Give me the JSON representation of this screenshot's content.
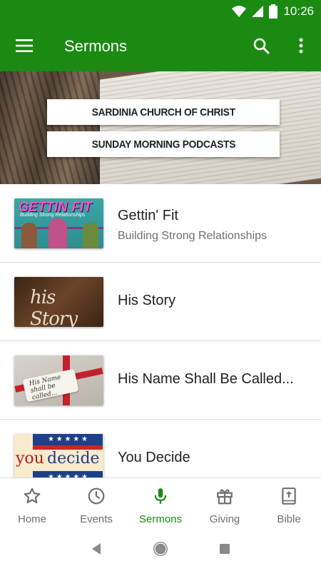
{
  "status_bar": {
    "time": "10:26"
  },
  "app_bar": {
    "title": "Sermons"
  },
  "banner": {
    "line1": "SARDINIA CHURCH OF CHRIST",
    "line2": "SUNDAY MORNING PODCASTS"
  },
  "sermons": [
    {
      "title": "Gettin' Fit",
      "subtitle": "Building Strong Relationships",
      "thumb_text": "GETTIN FIT",
      "thumb_subtext": "Building Strong Relationships"
    },
    {
      "title": "His Story",
      "subtitle": "",
      "thumb_text": "his Story"
    },
    {
      "title": "His Name Shall Be Called...",
      "subtitle": "",
      "thumb_text": "His Name shall be called..."
    },
    {
      "title": "You Decide",
      "subtitle": "",
      "thumb_text_1": "you",
      "thumb_text_2": "decide"
    }
  ],
  "bottom_nav": [
    {
      "label": "Home",
      "icon": "star-icon",
      "active": false
    },
    {
      "label": "Events",
      "icon": "clock-icon",
      "active": false
    },
    {
      "label": "Sermons",
      "icon": "microphone-icon",
      "active": true
    },
    {
      "label": "Giving",
      "icon": "gift-icon",
      "active": false
    },
    {
      "label": "Bible",
      "icon": "bible-icon",
      "active": false
    }
  ],
  "colors": {
    "primary": "#1b8a12",
    "text_primary": "#212121",
    "text_secondary": "#6f6f6f",
    "nav_inactive": "#6f6f6f"
  }
}
